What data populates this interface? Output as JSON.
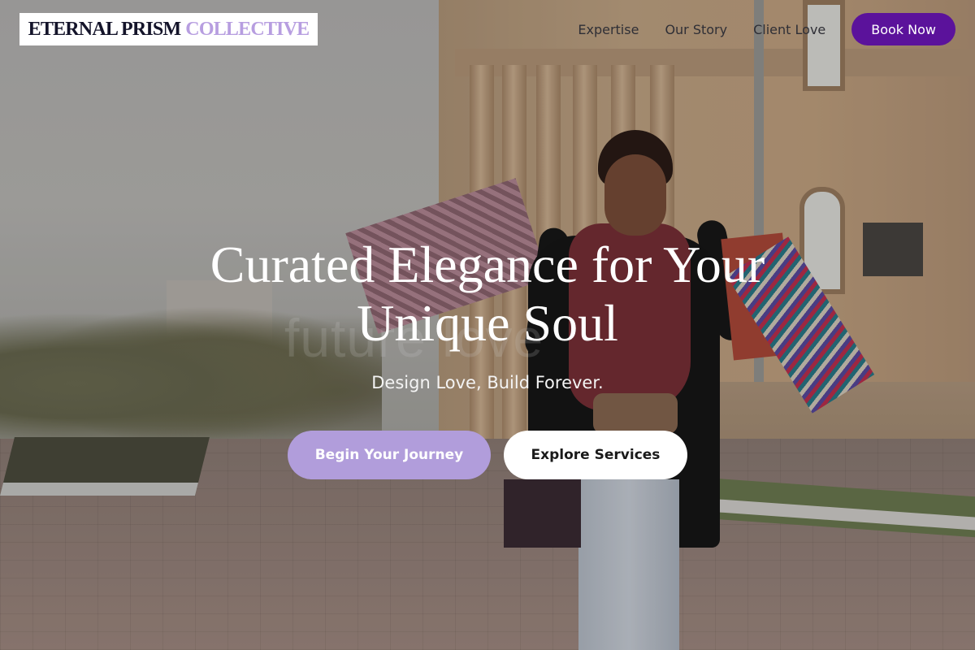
{
  "brand": {
    "name_primary": "ETERNAL PRISM",
    "name_accent": "COLLECTIVE"
  },
  "nav": {
    "links": [
      "Expertise",
      "Our Story",
      "Client Love"
    ],
    "cta_label": "Book Now"
  },
  "hero": {
    "headline_line1": "Curated Elegance for Your",
    "headline_line2": "Unique Soul",
    "tagline": "Design Love, Build Forever.",
    "primary_cta": "Begin Your Journey",
    "secondary_cta": "Explore Services",
    "background_watermark": "future love",
    "background_image": "woman-shopping-bags-street-photo"
  },
  "colors": {
    "accent_dark_purple": "#5b129b",
    "accent_lavender": "#b19ddb",
    "logo_accent": "#b79ee0",
    "logo_dark": "#14142a"
  }
}
